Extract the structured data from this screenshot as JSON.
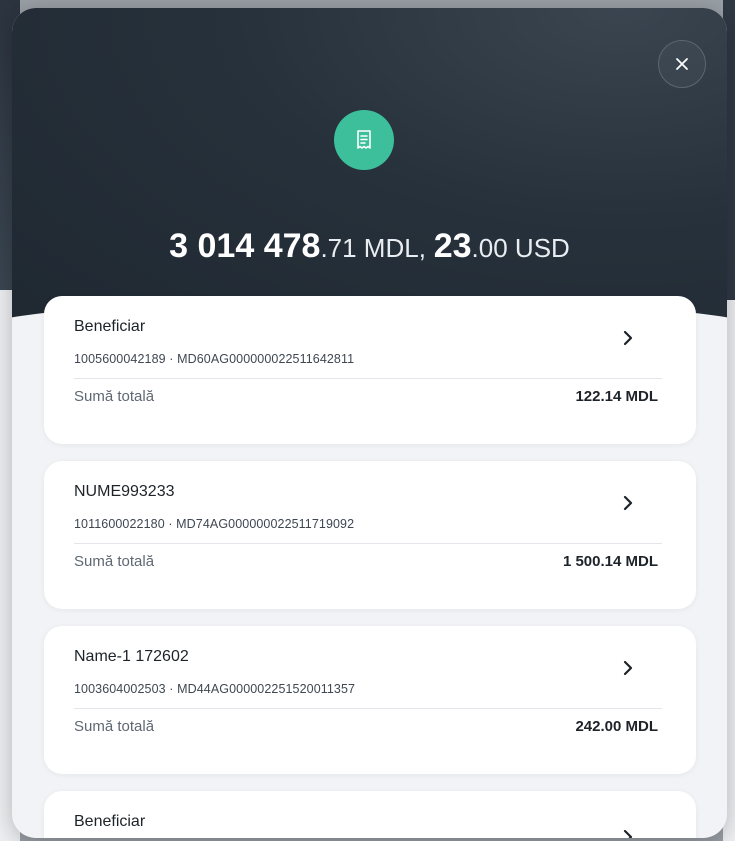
{
  "header": {
    "total_main_mdl": "3 014 478",
    "total_frac_mdl": ".71 MDL,",
    "total_main_usd": "23",
    "total_frac_usd": ".00 USD"
  },
  "colors": {
    "accent": "#3dbf9b",
    "header_dark": "#27313b"
  },
  "icons": {
    "close": "close-icon",
    "receipt": "receipt-icon",
    "chevron": "chevron-right-icon"
  },
  "cards": [
    {
      "name": "Beneficiar",
      "ids": "1005600042189 · MD60AG000000022511642811",
      "total_label": "Sumă totală",
      "total_value": "122.14 MDL"
    },
    {
      "name": "NUME993233",
      "ids": "1011600022180 · MD74AG000000022511719092",
      "total_label": "Sumă totală",
      "total_value": "1 500.14 MDL"
    },
    {
      "name": "Name-1 172602",
      "ids": "1003604002503 · MD44AG000002251520011357",
      "total_label": "Sumă totală",
      "total_value": "242.00 MDL"
    },
    {
      "name": "Beneficiar"
    }
  ]
}
